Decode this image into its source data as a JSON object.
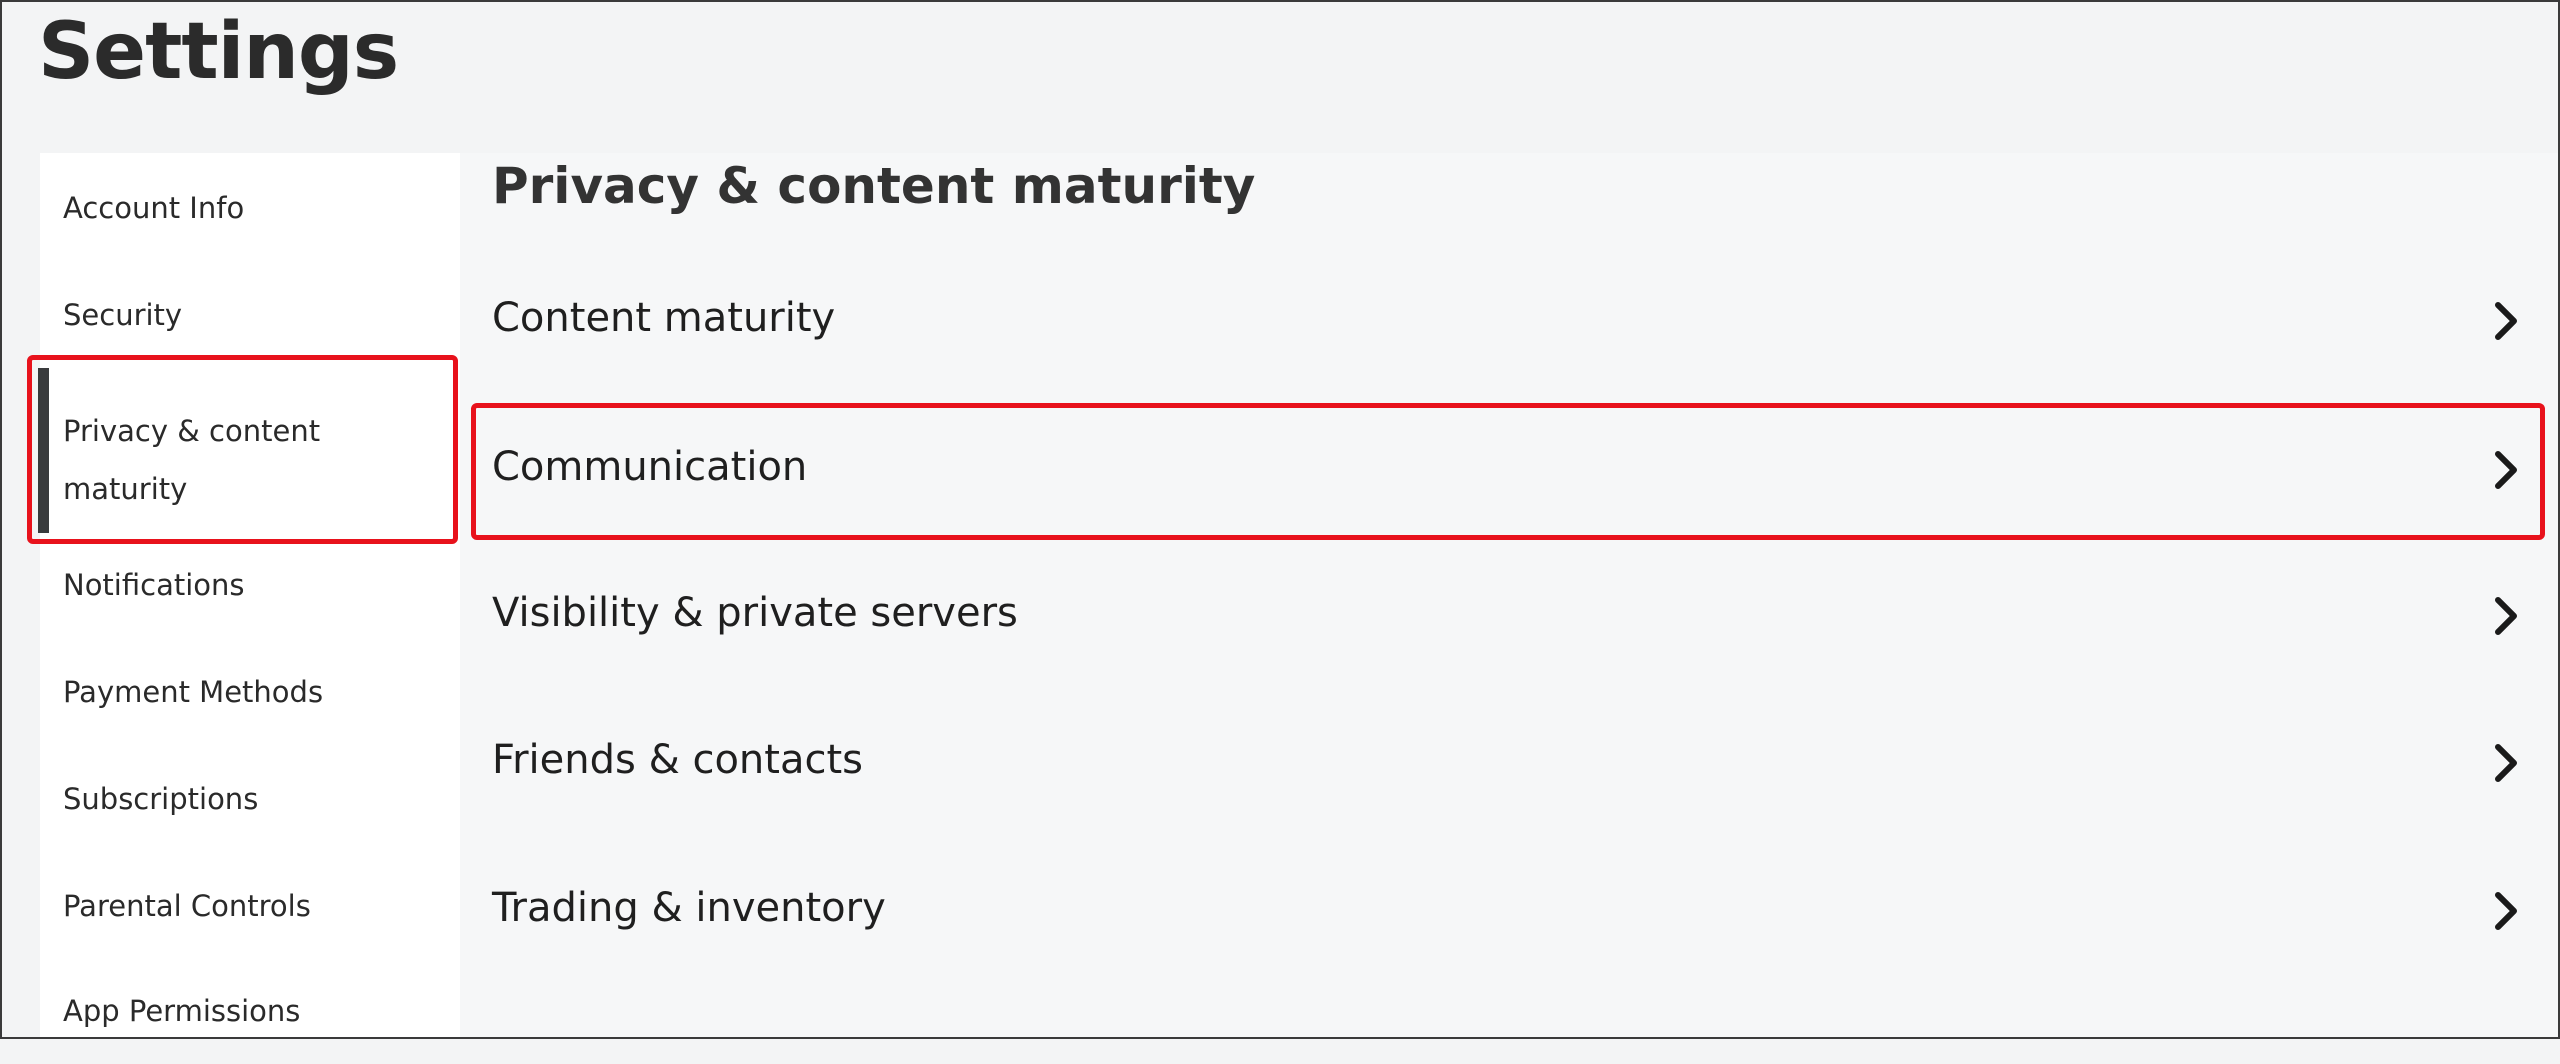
{
  "page": {
    "title": "Settings"
  },
  "sidebar": {
    "items": [
      {
        "label": "Account Info",
        "active": false
      },
      {
        "label": "Security",
        "active": false
      },
      {
        "label": "Privacy & content maturity",
        "active": true
      },
      {
        "label": "Notifications",
        "active": false
      },
      {
        "label": "Payment Methods",
        "active": false
      },
      {
        "label": "Subscriptions",
        "active": false
      },
      {
        "label": "Parental Controls",
        "active": false
      },
      {
        "label": "App Permissions",
        "active": false
      }
    ]
  },
  "main": {
    "section_title": "Privacy & content maturity",
    "rows": [
      {
        "label": "Content maturity",
        "icon": "chevron-right-icon"
      },
      {
        "label": "Communication",
        "icon": "chevron-right-icon",
        "highlighted": true
      },
      {
        "label": "Visibility & private servers",
        "icon": "chevron-right-icon"
      },
      {
        "label": "Friends & contacts",
        "icon": "chevron-right-icon"
      },
      {
        "label": "Trading & inventory",
        "icon": "chevron-right-icon"
      }
    ]
  },
  "colors": {
    "highlight": "#e8121c",
    "active_indicator": "#393b3d",
    "text": "#1f1f1f"
  }
}
